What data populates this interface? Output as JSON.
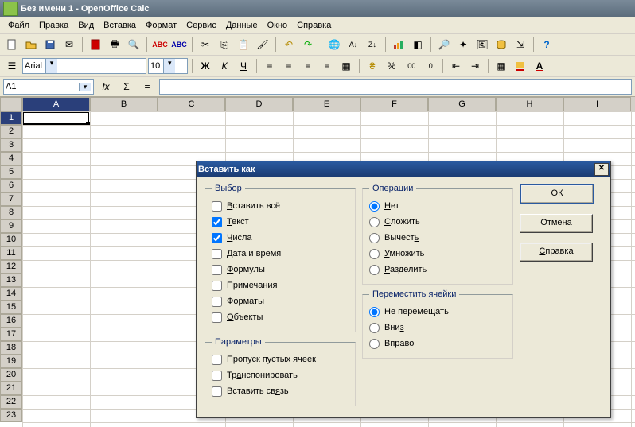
{
  "title": "Без имени 1 - OpenOffice Calc",
  "menu": [
    "Файл",
    "Правка",
    "Вид",
    "Вставка",
    "Формат",
    "Сервис",
    "Данные",
    "Окно",
    "Справка"
  ],
  "font": {
    "name": "Arial",
    "size": "10"
  },
  "cellref": "A1",
  "columns": [
    "A",
    "B",
    "C",
    "D",
    "E",
    "F",
    "G",
    "H",
    "I"
  ],
  "rows": [
    "1",
    "2",
    "3",
    "4",
    "5",
    "6",
    "7",
    "8",
    "9",
    "10",
    "11",
    "12",
    "13",
    "14",
    "15",
    "16",
    "17",
    "18",
    "19",
    "20",
    "21",
    "22",
    "23"
  ],
  "dialog": {
    "title": "Вставить как",
    "groups": {
      "selection": "Выбор",
      "operations": "Операции",
      "params": "Параметры",
      "shift": "Переместить ячейки"
    },
    "selection": [
      {
        "label": "Вставить всё",
        "checked": false,
        "mn": "В"
      },
      {
        "label": "Текст",
        "checked": true,
        "mn": "Т"
      },
      {
        "label": "Числа",
        "checked": true,
        "mn": "Ч"
      },
      {
        "label": "Дата и время",
        "checked": false,
        "mn": "Д"
      },
      {
        "label": "Формулы",
        "checked": false,
        "mn": "Ф"
      },
      {
        "label": "Примечания",
        "checked": false
      },
      {
        "label": "Форматы",
        "checked": false,
        "mn": "ы"
      },
      {
        "label": "Объекты",
        "checked": false,
        "mn": "О"
      }
    ],
    "operations": [
      {
        "label": "Нет",
        "checked": true,
        "mn": "Н"
      },
      {
        "label": "Сложить",
        "checked": false,
        "mn": "С"
      },
      {
        "label": "Вычесть",
        "checked": false,
        "mn": "ь"
      },
      {
        "label": "Умножить",
        "checked": false,
        "mn": "У"
      },
      {
        "label": "Разделить",
        "checked": false,
        "mn": "Р"
      }
    ],
    "params": [
      {
        "label": "Пропуск пустых ячеек",
        "checked": false,
        "mn": "П"
      },
      {
        "label": "Транспонировать",
        "checked": false,
        "mn": "а"
      },
      {
        "label": "Вставить связь",
        "checked": false,
        "mn": "я"
      }
    ],
    "shift": [
      {
        "label": "Не перемещать",
        "checked": true
      },
      {
        "label": "Вниз",
        "checked": false,
        "mn": "з"
      },
      {
        "label": "Вправо",
        "checked": false,
        "mn": "о"
      }
    ],
    "buttons": {
      "ok": "ОК",
      "cancel": "Отмена",
      "help": "Справка"
    }
  }
}
